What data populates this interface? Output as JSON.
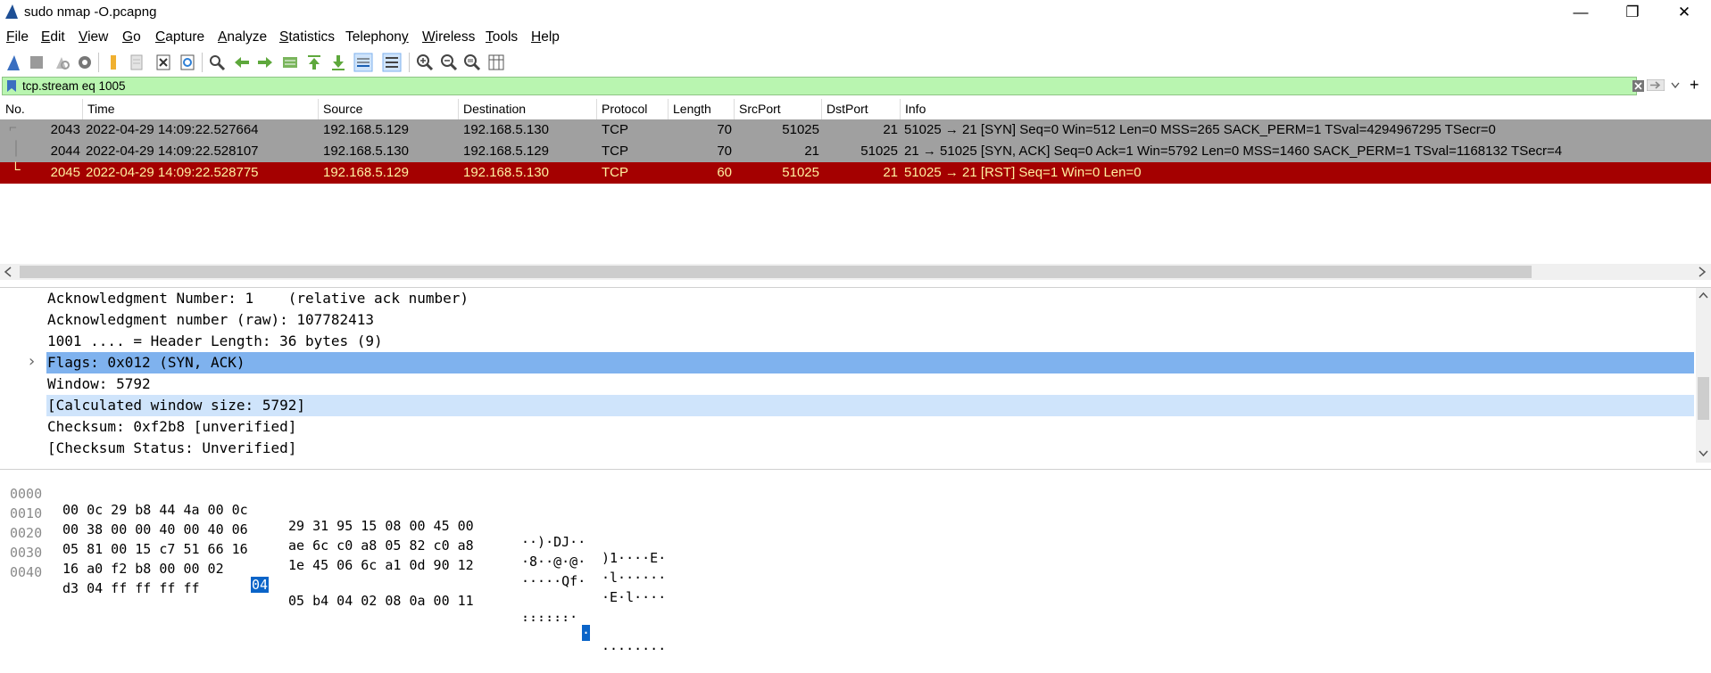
{
  "window": {
    "title": "sudo nmap -O.pcapng",
    "minimize_glyph": "—",
    "restore_glyph": "❐",
    "close_glyph": "✕"
  },
  "menu": [
    {
      "prefix": "",
      "u": "F",
      "rest": "ile"
    },
    {
      "prefix": "",
      "u": "E",
      "rest": "dit"
    },
    {
      "prefix": "",
      "u": "V",
      "rest": "iew"
    },
    {
      "prefix": "",
      "u": "G",
      "rest": "o"
    },
    {
      "prefix": "",
      "u": "C",
      "rest": "apture"
    },
    {
      "prefix": "",
      "u": "A",
      "rest": "nalyze"
    },
    {
      "prefix": "",
      "u": "S",
      "rest": "tatistics"
    },
    {
      "prefix": "Telephon",
      "u": "y",
      "rest": ""
    },
    {
      "prefix": "",
      "u": "W",
      "rest": "ireless"
    },
    {
      "prefix": "",
      "u": "T",
      "rest": "ools"
    },
    {
      "prefix": "",
      "u": "H",
      "rest": "elp"
    }
  ],
  "filter": {
    "value": "tcp.stream eq 1005",
    "add_glyph": "+"
  },
  "packet_list": {
    "columns": [
      "No.",
      "Time",
      "Source",
      "Destination",
      "Protocol",
      "Length",
      "SrcPort",
      "DstPort",
      "Info"
    ],
    "rows": [
      {
        "no": "2043",
        "time": "2022-04-29 14:09:22.527664",
        "src": "192.168.5.129",
        "dst": "192.168.5.130",
        "proto": "TCP",
        "len": "70",
        "srcport": "51025",
        "dstport": "21",
        "info": "51025 → 21 [SYN] Seq=0 Win=512 Len=0 MSS=265 SACK_PERM=1 TSval=4294967295 TSecr=0",
        "style": "gray"
      },
      {
        "no": "2044",
        "time": "2022-04-29 14:09:22.528107",
        "src": "192.168.5.130",
        "dst": "192.168.5.129",
        "proto": "TCP",
        "len": "70",
        "srcport": "21",
        "dstport": "51025",
        "info": "21 → 51025 [SYN, ACK] Seq=0 Ack=1 Win=5792 Len=0 MSS=1460 SACK_PERM=1 TSval=1168132 TSecr=4",
        "style": "gray"
      },
      {
        "no": "2045",
        "time": "2022-04-29 14:09:22.528775",
        "src": "192.168.5.129",
        "dst": "192.168.5.130",
        "proto": "TCP",
        "len": "60",
        "srcport": "51025",
        "dstport": "21",
        "info": "51025 → 21 [RST] Seq=1 Win=0 Len=0",
        "style": "red"
      }
    ]
  },
  "details": [
    {
      "text": "Acknowledgment Number: 1    (relative ack number)",
      "style": "plain"
    },
    {
      "text": "Acknowledgment number (raw): 107782413",
      "style": "plain"
    },
    {
      "text": "1001 .... = Header Length: 36 bytes (9)",
      "style": "plain"
    },
    {
      "text": "Flags: 0x012 (SYN, ACK)",
      "style": "selected",
      "expander": "›"
    },
    {
      "text": "Window: 5792",
      "style": "plain"
    },
    {
      "text": "[Calculated window size: 5792]",
      "style": "related"
    },
    {
      "text": "Checksum: 0xf2b8 [unverified]",
      "style": "plain"
    },
    {
      "text": "[Checksum Status: Unverified]",
      "style": "plain"
    }
  ],
  "bytes": [
    {
      "offset": "0000",
      "hex1": "00 0c 29 b8 44 4a 00 0c",
      "hex2": "29 31 95 15 08 00 45 00",
      "ascii1": "··)·DJ··",
      "ascii2": ")1····E·"
    },
    {
      "offset": "0010",
      "hex1": "00 38 00 00 40 00 40 06",
      "hex2": "ae 6c c0 a8 05 82 c0 a8",
      "ascii1": "·8··@·@·",
      "ascii2": "·l······"
    },
    {
      "offset": "0020",
      "hex1": "05 81 00 15 c7 51 66 16",
      "hex2": "1e 45 06 6c a1 0d 90 12",
      "ascii1": "·····Qf·",
      "ascii2": "·E·l····"
    },
    {
      "offset": "0030",
      "hex1": "16 a0 f2 b8 00 00 02 ",
      "hex_sel": "04",
      "hex2": "05 b4 04 02 08 0a 00 11",
      "ascii1": "·······",
      "ascii_sel": "·",
      "ascii2": "········"
    },
    {
      "offset": "0040",
      "hex1": "d3 04 ff ff ff ff",
      "hex2": "",
      "ascii1": "······",
      "ascii2": ""
    }
  ],
  "colors": {
    "gray_row": "#a0a0a0",
    "red_row": "#a40000",
    "red_row_text": "#fff0a0",
    "selected_detail": "#7fb2ee",
    "related_detail": "#cfe4fb",
    "filter_bg": "#b9f5b0",
    "hex_select": "#0a64c8"
  }
}
